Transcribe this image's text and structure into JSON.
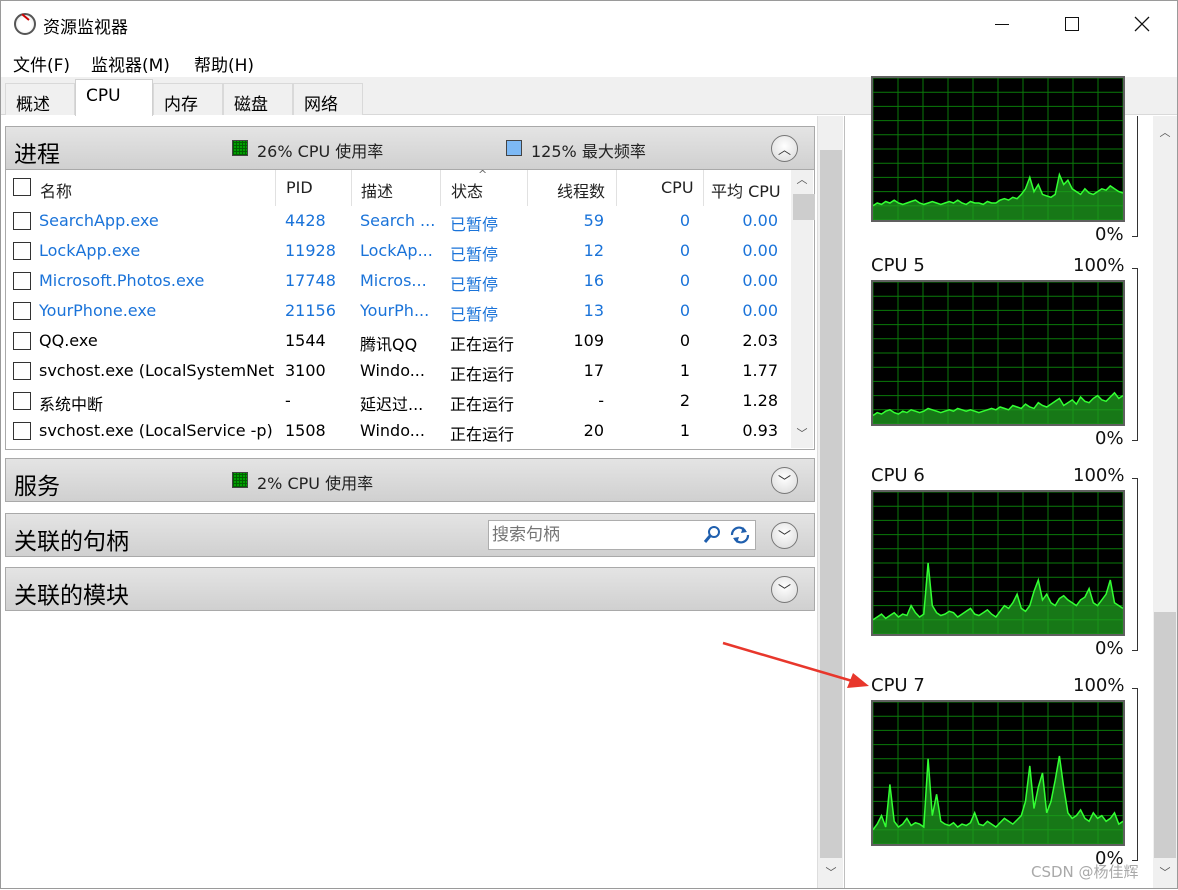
{
  "window": {
    "title": "资源监视器"
  },
  "menu": {
    "file": "文件(F)",
    "monitor": "监视器(M)",
    "help": "帮助(H)"
  },
  "tabs": [
    "概述",
    "CPU",
    "内存",
    "磁盘",
    "网络"
  ],
  "process_section": {
    "title": "进程",
    "cpu_usage": "26% CPU 使用率",
    "max_freq": "125% 最大频率",
    "columns": [
      "名称",
      "PID",
      "描述",
      "状态",
      "线程数",
      "CPU",
      "平均 CPU"
    ],
    "rows": [
      {
        "name": "SearchApp.exe",
        "pid": "4428",
        "desc": "Search ...",
        "status": "已暂停",
        "threads": "59",
        "cpu": "0",
        "avg": "0.00",
        "suspended": true
      },
      {
        "name": "LockApp.exe",
        "pid": "11928",
        "desc": "LockAp...",
        "status": "已暂停",
        "threads": "12",
        "cpu": "0",
        "avg": "0.00",
        "suspended": true
      },
      {
        "name": "Microsoft.Photos.exe",
        "pid": "17748",
        "desc": "Micros...",
        "status": "已暂停",
        "threads": "16",
        "cpu": "0",
        "avg": "0.00",
        "suspended": true
      },
      {
        "name": "YourPhone.exe",
        "pid": "21156",
        "desc": "YourPh...",
        "status": "已暂停",
        "threads": "13",
        "cpu": "0",
        "avg": "0.00",
        "suspended": true
      },
      {
        "name": "QQ.exe",
        "pid": "1544",
        "desc": "腾讯QQ",
        "status": "正在运行",
        "threads": "109",
        "cpu": "0",
        "avg": "2.03",
        "suspended": false
      },
      {
        "name": "svchost.exe (LocalSystemNet...",
        "pid": "3100",
        "desc": "Windo...",
        "status": "正在运行",
        "threads": "17",
        "cpu": "1",
        "avg": "1.77",
        "suspended": false
      },
      {
        "name": "系统中断",
        "pid": "-",
        "desc": "延迟过...",
        "status": "正在运行",
        "threads": "-",
        "cpu": "2",
        "avg": "1.28",
        "suspended": false
      },
      {
        "name": "svchost.exe (LocalService -p)",
        "pid": "1508",
        "desc": "Windo...",
        "status": "正在运行",
        "threads": "20",
        "cpu": "1",
        "avg": "0.93",
        "suspended": false
      }
    ]
  },
  "services_section": {
    "title": "服务",
    "cpu_usage": "2% CPU 使用率"
  },
  "handles_section": {
    "title": "关联的句柄",
    "search_placeholder": "搜索句柄"
  },
  "modules_section": {
    "title": "关联的模块"
  },
  "graphs": [
    {
      "label": "",
      "max": "",
      "min": "0%",
      "series": [
        10,
        12,
        11,
        13,
        12,
        14,
        12,
        11,
        12,
        13,
        14,
        12,
        11,
        12,
        13,
        12,
        11,
        12,
        13,
        12,
        14,
        12,
        11,
        13,
        12,
        12,
        11,
        13,
        12,
        12,
        14,
        15,
        14,
        16,
        15,
        18,
        22,
        30,
        20,
        25,
        18,
        17,
        16,
        18,
        32,
        25,
        28,
        22,
        20,
        18,
        22,
        19,
        18,
        20,
        22,
        21,
        24,
        22,
        20,
        19
      ]
    },
    {
      "label": "CPU 5",
      "max": "100%",
      "min": "0%",
      "series": [
        6,
        8,
        7,
        9,
        10,
        8,
        7,
        9,
        8,
        10,
        9,
        8,
        9,
        11,
        10,
        9,
        8,
        9,
        10,
        9,
        11,
        10,
        9,
        10,
        9,
        8,
        9,
        10,
        11,
        10,
        12,
        11,
        10,
        13,
        12,
        11,
        14,
        12,
        11,
        15,
        13,
        12,
        14,
        16,
        18,
        13,
        15,
        17,
        14,
        19,
        16,
        15,
        18,
        20,
        17,
        16,
        19,
        22,
        18,
        20
      ]
    },
    {
      "label": "CPU 6",
      "max": "100%",
      "min": "0%",
      "series": [
        10,
        12,
        14,
        11,
        13,
        15,
        12,
        14,
        13,
        20,
        15,
        12,
        14,
        50,
        20,
        15,
        13,
        14,
        16,
        15,
        12,
        14,
        16,
        18,
        14,
        13,
        15,
        17,
        14,
        12,
        16,
        20,
        18,
        22,
        28,
        18,
        16,
        20,
        30,
        38,
        24,
        28,
        22,
        20,
        25,
        27,
        24,
        22,
        20,
        24,
        26,
        32,
        22,
        20,
        24,
        28,
        38,
        22,
        20,
        18
      ]
    },
    {
      "label": "CPU 7",
      "max": "100%",
      "min": "0%",
      "series": [
        10,
        14,
        20,
        12,
        42,
        16,
        12,
        14,
        18,
        13,
        15,
        14,
        12,
        60,
        20,
        35,
        16,
        14,
        13,
        15,
        12,
        14,
        13,
        15,
        22,
        14,
        13,
        16,
        14,
        12,
        15,
        18,
        16,
        14,
        17,
        20,
        30,
        55,
        25,
        40,
        50,
        22,
        30,
        45,
        62,
        40,
        22,
        18,
        20,
        24,
        18,
        16,
        22,
        18,
        20,
        16,
        18,
        22,
        14,
        16
      ]
    }
  ],
  "watermark": "CSDN @杨佳辉"
}
